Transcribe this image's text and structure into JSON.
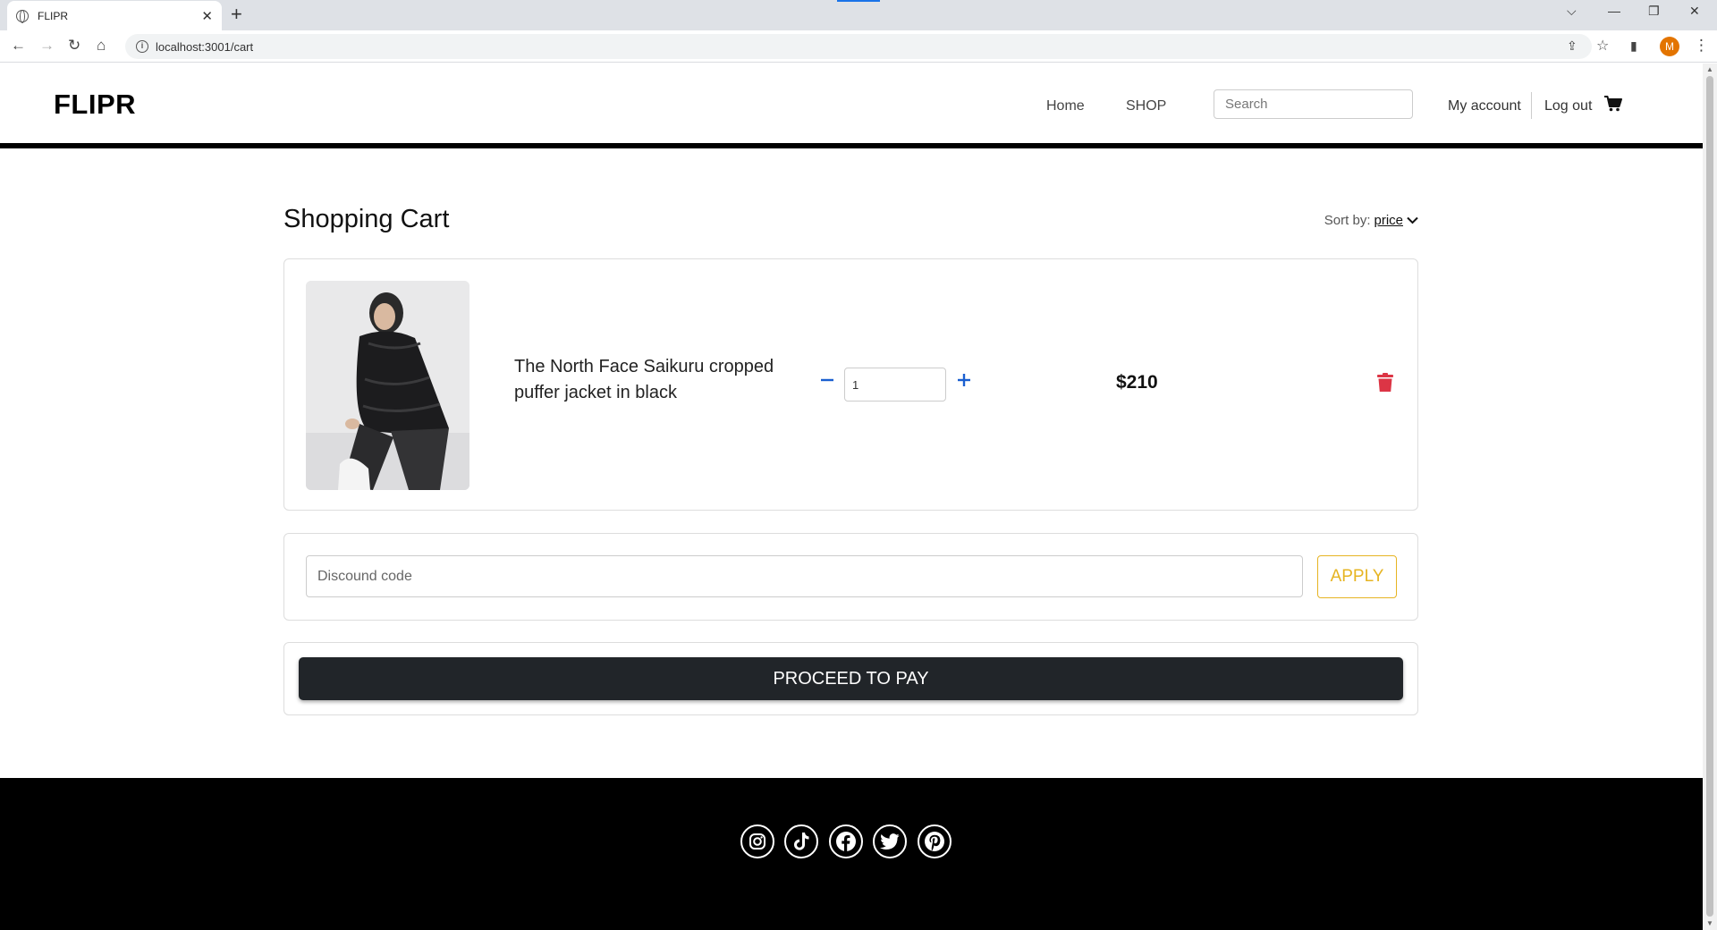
{
  "browser": {
    "tab_title": "FLIPR",
    "tab_close": "✕",
    "new_tab": "+",
    "url": "localhost:3001/cart",
    "profile_initial": "M"
  },
  "site": {
    "brand": "FLIPR",
    "nav": {
      "home": "Home",
      "shop": "SHOP",
      "my_account": "My account",
      "log_out": "Log out"
    },
    "search": {
      "placeholder": "Search"
    }
  },
  "cart": {
    "title": "Shopping Cart",
    "sort": {
      "label": "Sort by:",
      "value": "price"
    },
    "items": [
      {
        "name": "The North Face Saikuru cropped puffer jacket in black",
        "quantity": "1",
        "price": "$210"
      }
    ],
    "discount": {
      "placeholder": "Discound code",
      "apply_label": "APPLY"
    },
    "proceed_label": "PROCEED TO PAY"
  },
  "footer": {
    "social": [
      "instagram-icon",
      "tiktok-icon",
      "facebook-icon",
      "twitter-icon",
      "pinterest-icon"
    ]
  },
  "colors": {
    "apply_accent": "#e6b422",
    "qty_buttons": "#1a5fd0",
    "trash": "#dc3545",
    "pay_button": "#212529",
    "footer": "#000000"
  }
}
